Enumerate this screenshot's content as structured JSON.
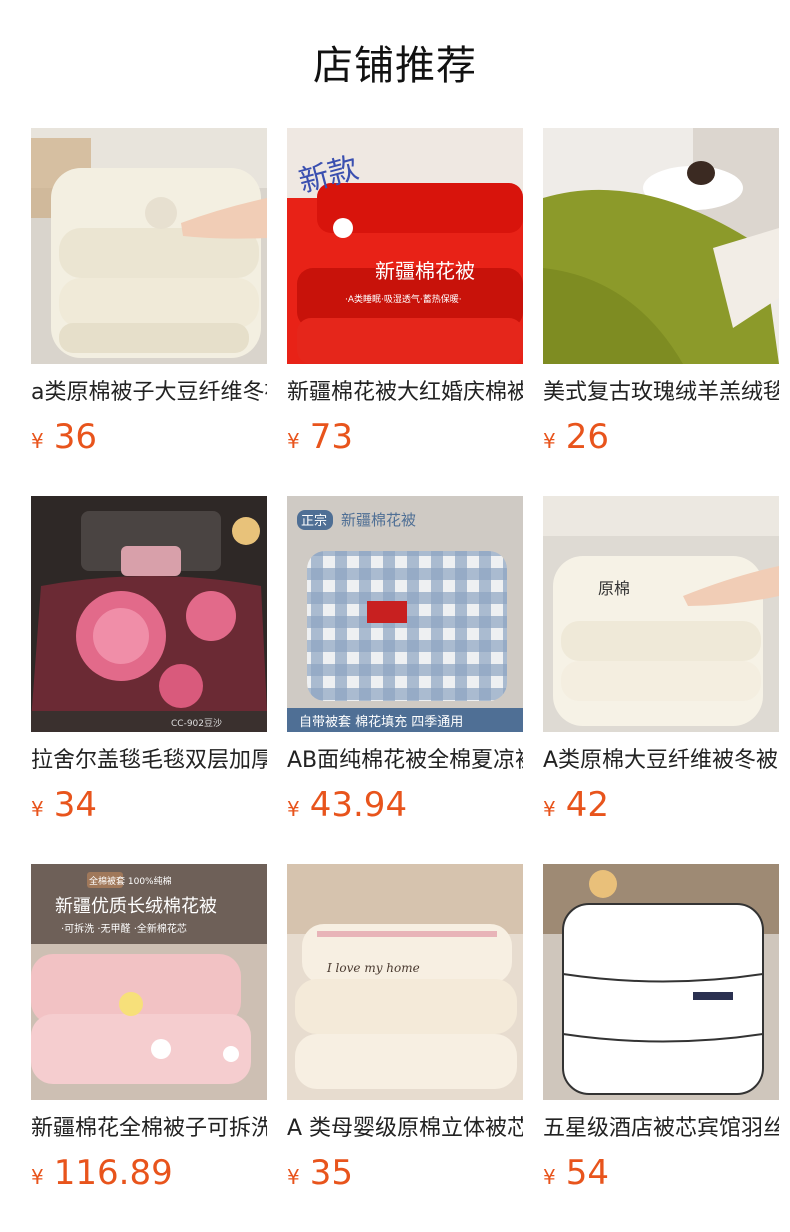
{
  "header": {
    "title": "店铺推荐"
  },
  "currency_symbol": "¥",
  "products": [
    {
      "name": "a类原棉被子大豆纤维冬被",
      "price": "36",
      "image": {
        "kind": "white-quilt",
        "text": ""
      }
    },
    {
      "name": "新疆棉花被大红婚庆棉被",
      "price": "73",
      "image": {
        "kind": "red-quilt",
        "text": "新疆棉花被",
        "badge": "新款",
        "sub": "·A类睡眠·吸湿透气·蓄热保暖·"
      }
    },
    {
      "name": "美式复古玫瑰绒羊羔绒毯",
      "price": "26",
      "image": {
        "kind": "green-blanket",
        "text": ""
      }
    },
    {
      "name": "拉舍尔盖毯毛毯双层加厚",
      "price": "34",
      "image": {
        "kind": "floral-blanket",
        "text": "CC-902豆沙"
      }
    },
    {
      "name": "AB面纯棉花被全棉夏凉被",
      "price": "43.94",
      "image": {
        "kind": "plaid-quilt",
        "text": "新疆棉花被",
        "badge": "正宗",
        "sub": "自带被套  棉花填充  四季通用"
      }
    },
    {
      "name": "A类原棉大豆纤维被冬被",
      "price": "42",
      "image": {
        "kind": "white-quilt-2",
        "text": "原棉"
      }
    },
    {
      "name": "新疆棉花全棉被子可拆洗",
      "price": "116.89",
      "image": {
        "kind": "pink-quilt",
        "text": "新疆优质长绒棉花被",
        "badge": "全棉被套 100%纯棉",
        "sub": "·可拆洗 ·无甲醛 ·全新棉花芯"
      }
    },
    {
      "name": "A 类母婴级原棉立体被芯",
      "price": "35",
      "image": {
        "kind": "cream-quilt",
        "text": "I love my home"
      }
    },
    {
      "name": "五星级酒店被芯宾馆羽丝绒",
      "price": "54",
      "image": {
        "kind": "hotel-quilt",
        "text": ""
      }
    }
  ]
}
